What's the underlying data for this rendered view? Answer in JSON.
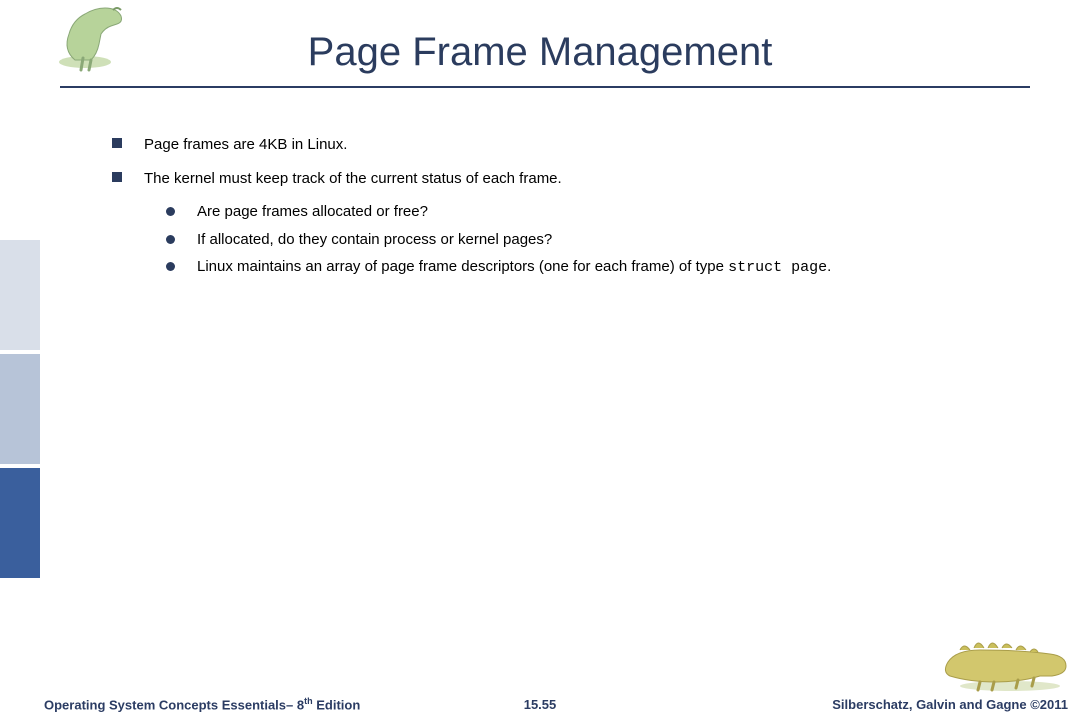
{
  "title": "Page Frame Management",
  "bullets": {
    "b1": "Page frames are 4KB in Linux.",
    "b2": "The kernel must keep track of the current status of each frame.",
    "s1": "Are page frames allocated or free?",
    "s2": "If allocated, do they contain process or kernel pages?",
    "s3_pre": "Linux maintains an array of page frame descriptors (one for each frame) of type ",
    "s3_code": "struct page",
    "s3_post": "."
  },
  "footer": {
    "left_pre": "Operating System Concepts Essentials– 8",
    "left_sup": "th",
    "left_post": " Edition",
    "mid": "15.55",
    "right": "Silberschatz, Galvin and Gagne ©2011"
  }
}
